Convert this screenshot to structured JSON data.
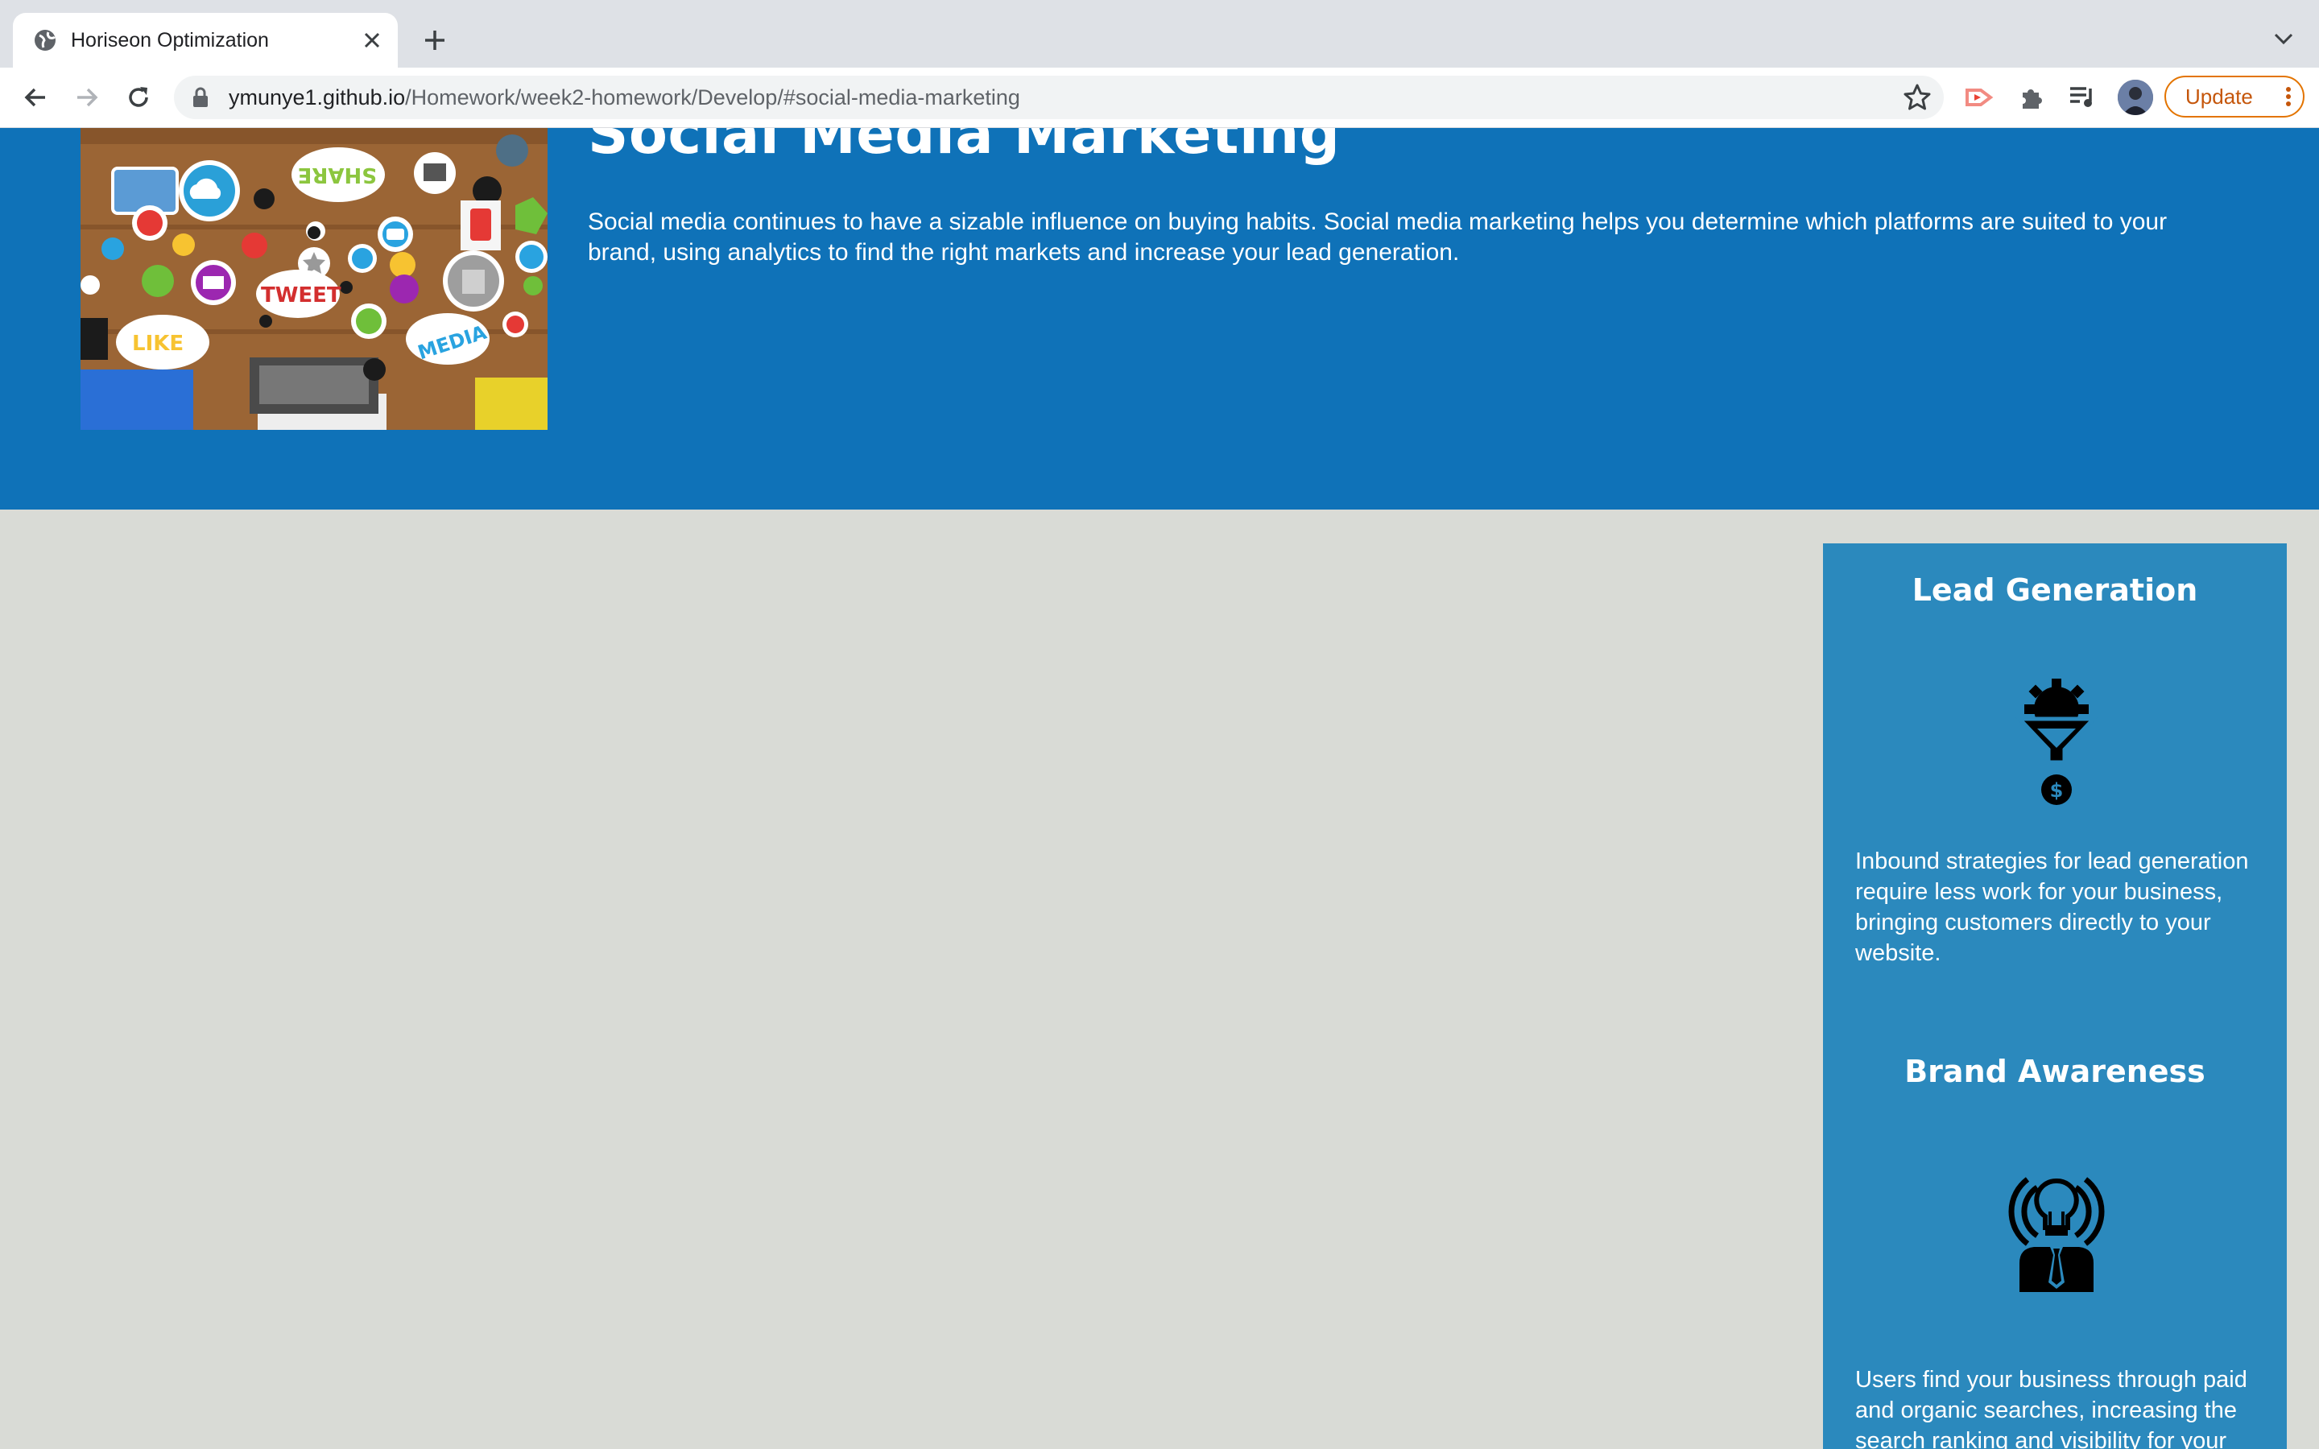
{
  "browser": {
    "tab_title": "Horiseon Optimization",
    "url_host": "ymunye1.github.io",
    "url_path": "/Homework/week2-homework/Develop/#social-media-marketing",
    "update_label": "Update"
  },
  "page": {
    "section": {
      "title": "Social Media Marketing",
      "text": "Social media continues to have a sizable influence on buying habits. Social media marketing helps you determine which platforms are suited to your brand, using analytics to find the right markets and increase your lead generation.",
      "image_words": [
        "SHARE",
        "TWEET",
        "LIKE",
        "MEDIA"
      ]
    },
    "benefits": [
      {
        "title": "Lead Generation",
        "icon": "lead-generation-icon",
        "text": "Inbound strategies for lead generation require less work for your business, bringing customers directly to your website."
      },
      {
        "title": "Brand Awareness",
        "icon": "brand-awareness-icon",
        "text": "Users find your business through paid and organic searches, increasing the search ranking and visibility for your business."
      }
    ]
  },
  "colors": {
    "hero_band": "#0f72b8",
    "benefits_panel": "#2b89bd",
    "page_background": "#d9dbd6",
    "update_accent": "#e37400"
  }
}
